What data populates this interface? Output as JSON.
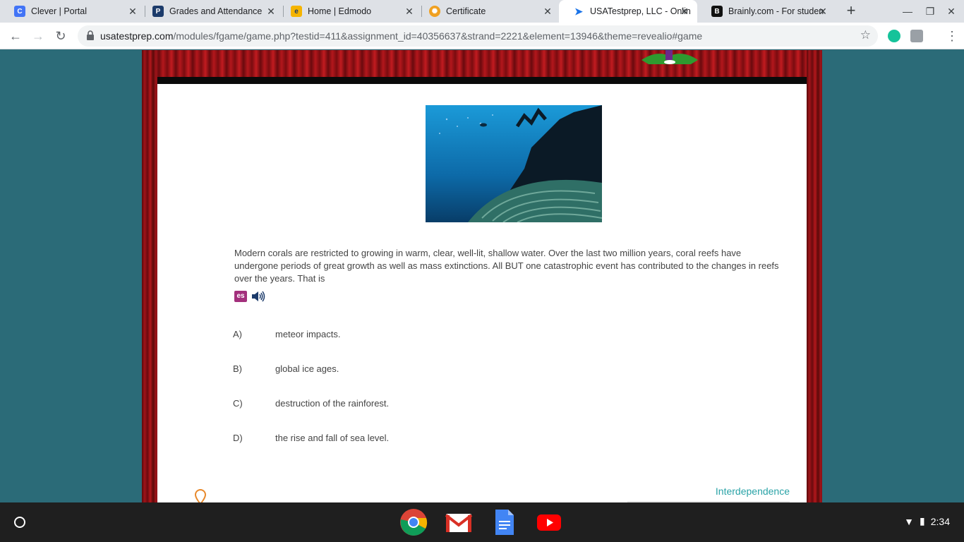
{
  "browser": {
    "tabs": [
      {
        "title": "Clever | Portal",
        "icon": "clever-icon",
        "active": false
      },
      {
        "title": "Grades and Attendance",
        "icon": "powerschool-icon",
        "active": false
      },
      {
        "title": "Home | Edmodo",
        "icon": "edmodo-icon",
        "active": false
      },
      {
        "title": "Certificate",
        "icon": "certificate-icon",
        "active": false
      },
      {
        "title": "USATestprep, LLC - Onlin",
        "icon": "cursor-icon",
        "active": true
      },
      {
        "title": "Brainly.com - For studen",
        "icon": "brainly-icon",
        "active": false
      }
    ],
    "url_host": "usatestprep.com",
    "url_path": "/modules/fgame/game.php?testid=411&assignment_id=40356637&strand=2221&element=13946&theme=revealio#game"
  },
  "page": {
    "question": "Modern corals are restricted to growing in warm, clear, well-lit, shallow water. Over the last two million years, coral reefs have undergone periods of great growth as well as mass extinctions. All BUT one catastrophic event has contributed to the changes in reefs over the years. That is",
    "translate_label": "es",
    "choices": [
      {
        "letter": "A)",
        "text": "meteor impacts."
      },
      {
        "letter": "B)",
        "text": "global ice ages."
      },
      {
        "letter": "C)",
        "text": "destruction of the rainforest."
      },
      {
        "letter": "D)",
        "text": "the rise and fall of sea level."
      }
    ],
    "topic": "Interdependence"
  },
  "shelf": {
    "apps": [
      "chrome-icon",
      "gmail-icon",
      "docs-icon",
      "youtube-icon"
    ],
    "time": "2:34"
  },
  "colors": {
    "background": "#2b6b78",
    "topic_link": "#2aa3a7",
    "es_badge": "#a3307c"
  }
}
